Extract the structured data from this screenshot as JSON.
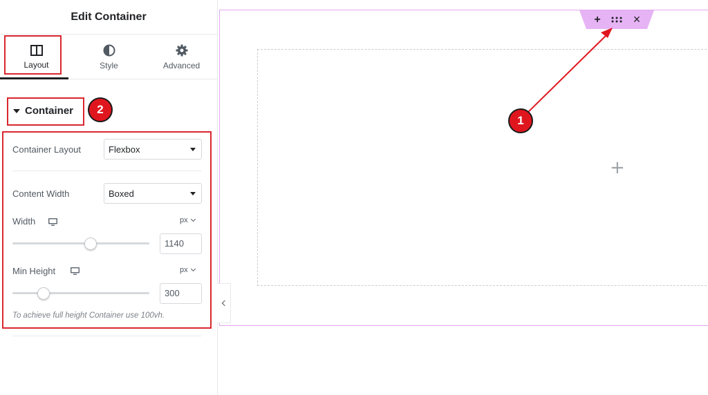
{
  "panel": {
    "title": "Edit Container",
    "tabs": [
      {
        "label": "Layout",
        "icon": "columns-icon",
        "active": true
      },
      {
        "label": "Style",
        "icon": "half-circle-icon",
        "active": false
      },
      {
        "label": "Advanced",
        "icon": "gear-icon",
        "active": false
      }
    ],
    "section": {
      "title": "Container",
      "expanded": true
    },
    "container_layout": {
      "label": "Container Layout",
      "value": "Flexbox"
    },
    "content_width": {
      "label": "Content Width",
      "value": "Boxed"
    },
    "width": {
      "label": "Width",
      "unit": "px",
      "value": "1140",
      "device_icon": "desktop-icon",
      "slider_fraction": 0.58
    },
    "min_height": {
      "label": "Min Height",
      "unit": "px",
      "value": "300",
      "device_icon": "desktop-icon",
      "slider_fraction": 0.2
    },
    "hint": "To achieve full height Container use 100vh."
  },
  "canvas": {
    "handle": {
      "add": "+",
      "drag_icon": "drag-dots-icon",
      "close": "×"
    },
    "add_element": "+"
  },
  "annotations": [
    {
      "number": "1"
    },
    {
      "number": "2"
    }
  ],
  "colors": {
    "annotation_red": "#e0161f",
    "handle_pink": "#e6b3f5",
    "container_outline": "#e2a7ef"
  }
}
